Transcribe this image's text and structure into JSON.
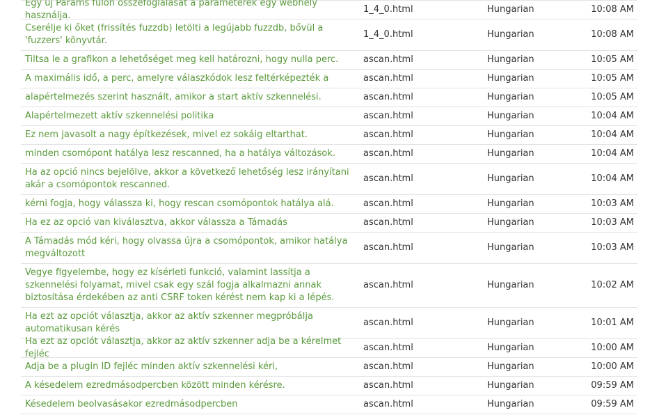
{
  "rows": [
    {
      "text": "Egy új Params fülön összefoglalását a paraméterek egy webhely használja.",
      "file": "1_4_0.html",
      "language": "Hungarian",
      "time": "10:08 AM"
    },
    {
      "text": "Cserélje ki őket (frissítés fuzzdb) letölti a legújabb fuzzdb, bővül a 'fuzzers' könyvtár.",
      "file": "1_4_0.html",
      "language": "Hungarian",
      "time": "10:08 AM"
    },
    {
      "text": "Tiltsa le a grafikon a lehetőséget meg kell határozni, hogy nulla perc.",
      "file": "ascan.html",
      "language": "Hungarian",
      "time": "10:05 AM"
    },
    {
      "text": "A maximális idő, a perc, amelyre válaszkódok lesz feltérképezték a",
      "file": "ascan.html",
      "language": "Hungarian",
      "time": "10:05 AM"
    },
    {
      "text": "alapértelmezés szerint használt, amikor a start aktív szkennelési.",
      "file": "ascan.html",
      "language": "Hungarian",
      "time": "10:05 AM"
    },
    {
      "text": "Alapértelmezett aktív szkennelési politika",
      "file": "ascan.html",
      "language": "Hungarian",
      "time": "10:04 AM"
    },
    {
      "text": "Ez nem javasolt a nagy építkezések, mivel ez sokáig eltarthat.",
      "file": "ascan.html",
      "language": "Hungarian",
      "time": "10:04 AM"
    },
    {
      "text": "minden csomópont hatálya lesz rescanned, ha a hatálya változások.",
      "file": "ascan.html",
      "language": "Hungarian",
      "time": "10:04 AM"
    },
    {
      "text": "Ha az opció nincs bejelölve, akkor a következő lehetőség lesz irányítani akár a csomópontok rescanned.",
      "file": "ascan.html",
      "language": "Hungarian",
      "time": "10:04 AM"
    },
    {
      "text": "kérni fogja, hogy válassza ki, hogy rescan csomópontok hatálya alá.",
      "file": "ascan.html",
      "language": "Hungarian",
      "time": "10:03 AM"
    },
    {
      "text": "Ha ez az opció van kiválasztva, akkor válassza a Támadás",
      "file": "ascan.html",
      "language": "Hungarian",
      "time": "10:03 AM"
    },
    {
      "text": "A Támadás mód kéri, hogy olvassa újra a csomópontok, amikor hatálya megváltozott",
      "file": "ascan.html",
      "language": "Hungarian",
      "time": "10:03 AM"
    },
    {
      "text": "Vegye figyelembe, hogy ez kísérleti funkció, valamint lassítja a szkennelési folyamat, mivel csak egy szál fogja alkalmazni annak biztosítása érdekében az anti CSRF token kérést nem kap ki a lépés.",
      "file": "ascan.html",
      "language": "Hungarian",
      "time": "10:02 AM"
    },
    {
      "text": "Ha ezt az opciót választja, akkor az aktív szkenner megpróbálja automatikusan kérés",
      "file": "ascan.html",
      "language": "Hungarian",
      "time": "10:01 AM"
    },
    {
      "text": "Ha ezt az opciót választja, akkor az aktív szkenner adja be a kérelmet fejléc",
      "file": "ascan.html",
      "language": "Hungarian",
      "time": "10:00 AM"
    },
    {
      "text": "Adja be a plugin ID fejléc minden aktív szkennelési kéri,",
      "file": "ascan.html",
      "language": "Hungarian",
      "time": "10:00 AM"
    },
    {
      "text": "A késedelem ezredmásodpercben között minden kérésre.",
      "file": "ascan.html",
      "language": "Hungarian",
      "time": "09:59 AM"
    },
    {
      "text": "Késedelem beolvasásakor ezredmásodpercben",
      "file": "ascan.html",
      "language": "Hungarian",
      "time": "09:59 AM"
    }
  ]
}
